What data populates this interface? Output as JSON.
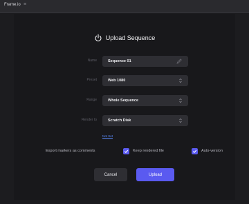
{
  "window": {
    "tab_title": "Frame.io",
    "tab_menu": "≡"
  },
  "dialog": {
    "title": "Upload Sequence",
    "fields": [
      {
        "label": "Name",
        "value": "Sequence 01",
        "control": "pencil"
      },
      {
        "label": "Preset",
        "value": "Web 1080",
        "control": "stepper"
      },
      {
        "label": "Range",
        "value": "Whole Sequence",
        "control": "stepper"
      },
      {
        "label": "Render to",
        "value": "Scratch Disk",
        "control": "stepper"
      }
    ],
    "link": "Not Set",
    "options": {
      "export_markers": "Export markers as comments",
      "keep_rendered": "Keep rendered file",
      "auto_version": "Auto-version"
    },
    "buttons": {
      "cancel": "Cancel",
      "upload": "Upload"
    }
  },
  "colors": {
    "accent": "#5a5af0",
    "link": "#5b8cff",
    "background": "#18181b",
    "field": "#2e2e33"
  }
}
